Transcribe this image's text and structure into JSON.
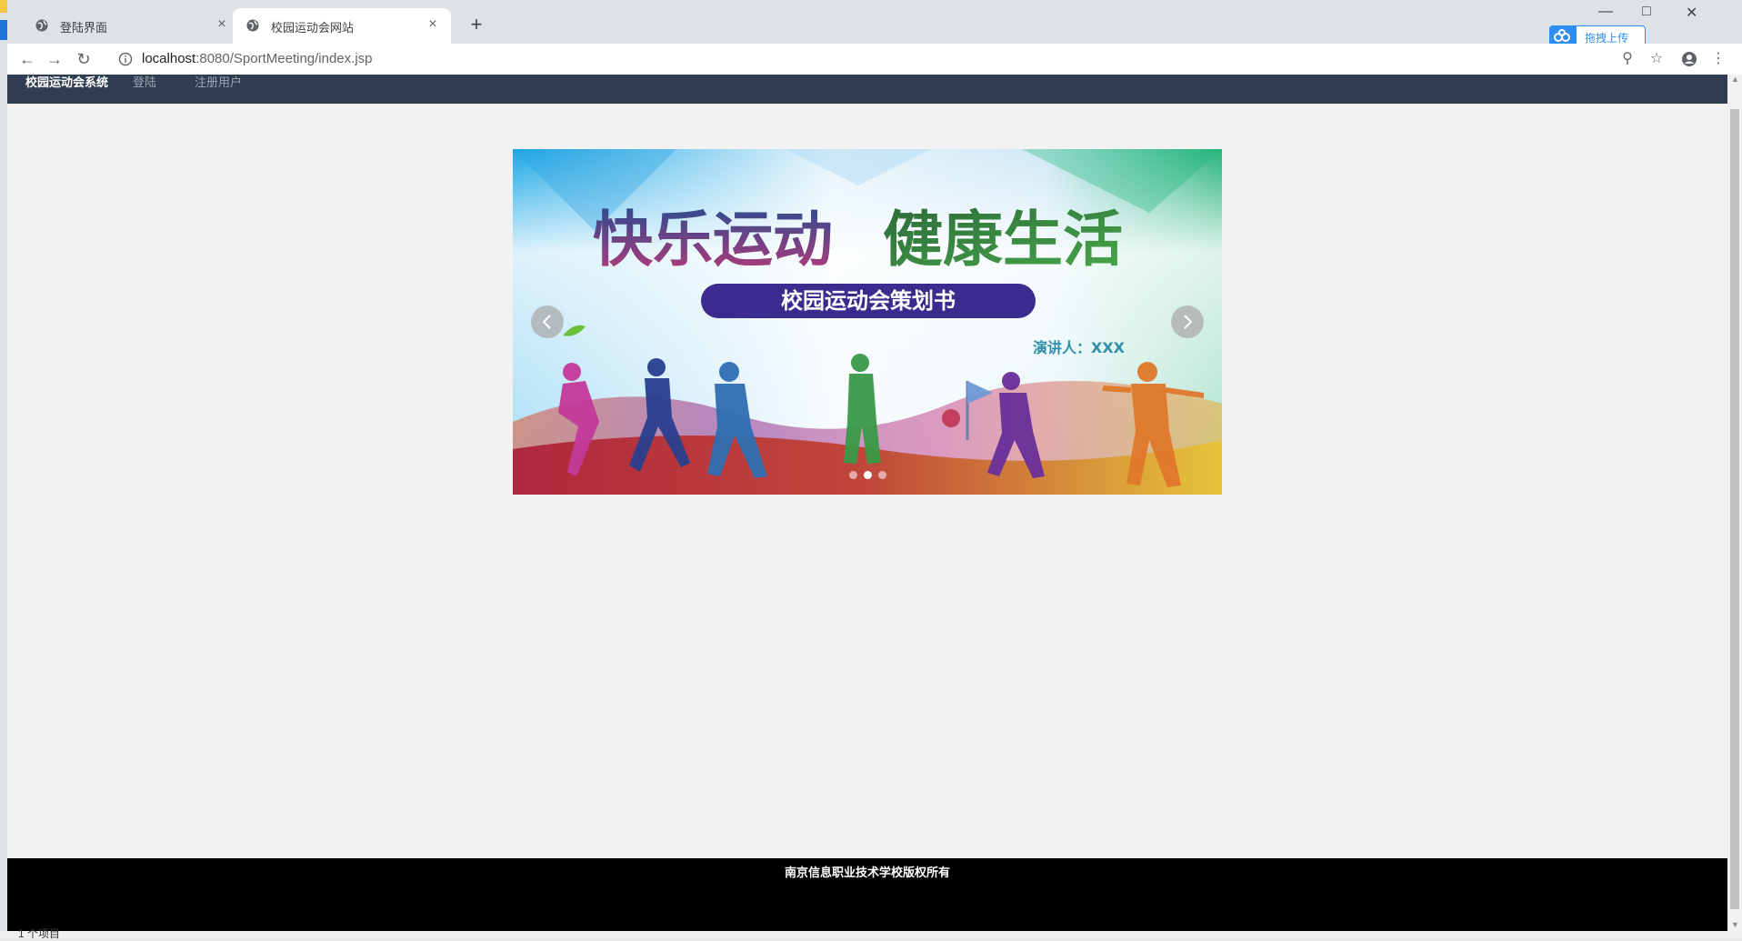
{
  "browser": {
    "tabs": [
      {
        "title": "登陆界面",
        "close": "×"
      },
      {
        "title": "校园运动会网站",
        "close": "×"
      }
    ],
    "new_tab": "+",
    "url_host": "localhost",
    "url_path": ":8080/SportMeeting/index.jsp",
    "upload_label": "拖拽上传"
  },
  "navbar": {
    "brand": "校园运动会系统",
    "links": [
      "登陆",
      "注册用户"
    ]
  },
  "carousel": {
    "headline_left": "快乐运动",
    "headline_right": "健康生活",
    "banner": "校园运动会策划书",
    "presenter": "演讲人：XXX",
    "slide_count": 3,
    "active_slide": 2
  },
  "footer": {
    "text": "南京信息职业技术学校版权所有"
  },
  "statusbar": {
    "text": "1 个项目"
  }
}
